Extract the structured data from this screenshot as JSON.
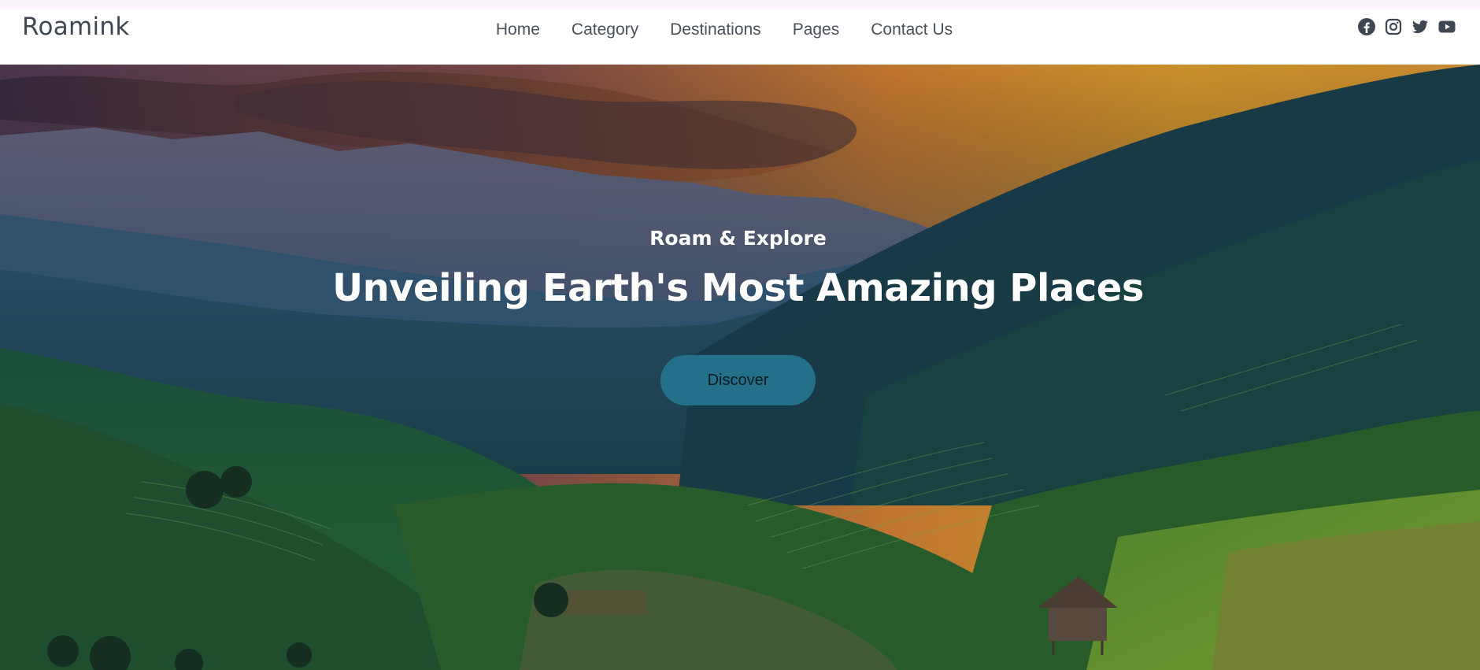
{
  "brand": {
    "name": "Roamink"
  },
  "nav": {
    "links": [
      {
        "label": "Home"
      },
      {
        "label": "Category"
      },
      {
        "label": "Destinations"
      },
      {
        "label": "Pages"
      },
      {
        "label": "Contact Us"
      }
    ]
  },
  "social": {
    "icons": [
      "facebook-icon",
      "instagram-icon",
      "twitter-icon",
      "youtube-icon"
    ],
    "color": "#3f4753"
  },
  "hero": {
    "subtitle": "Roam & Explore",
    "title": "Unveiling Earth's Most Amazing Places",
    "cta_label": "Discover",
    "cta_color": "#24708a"
  }
}
